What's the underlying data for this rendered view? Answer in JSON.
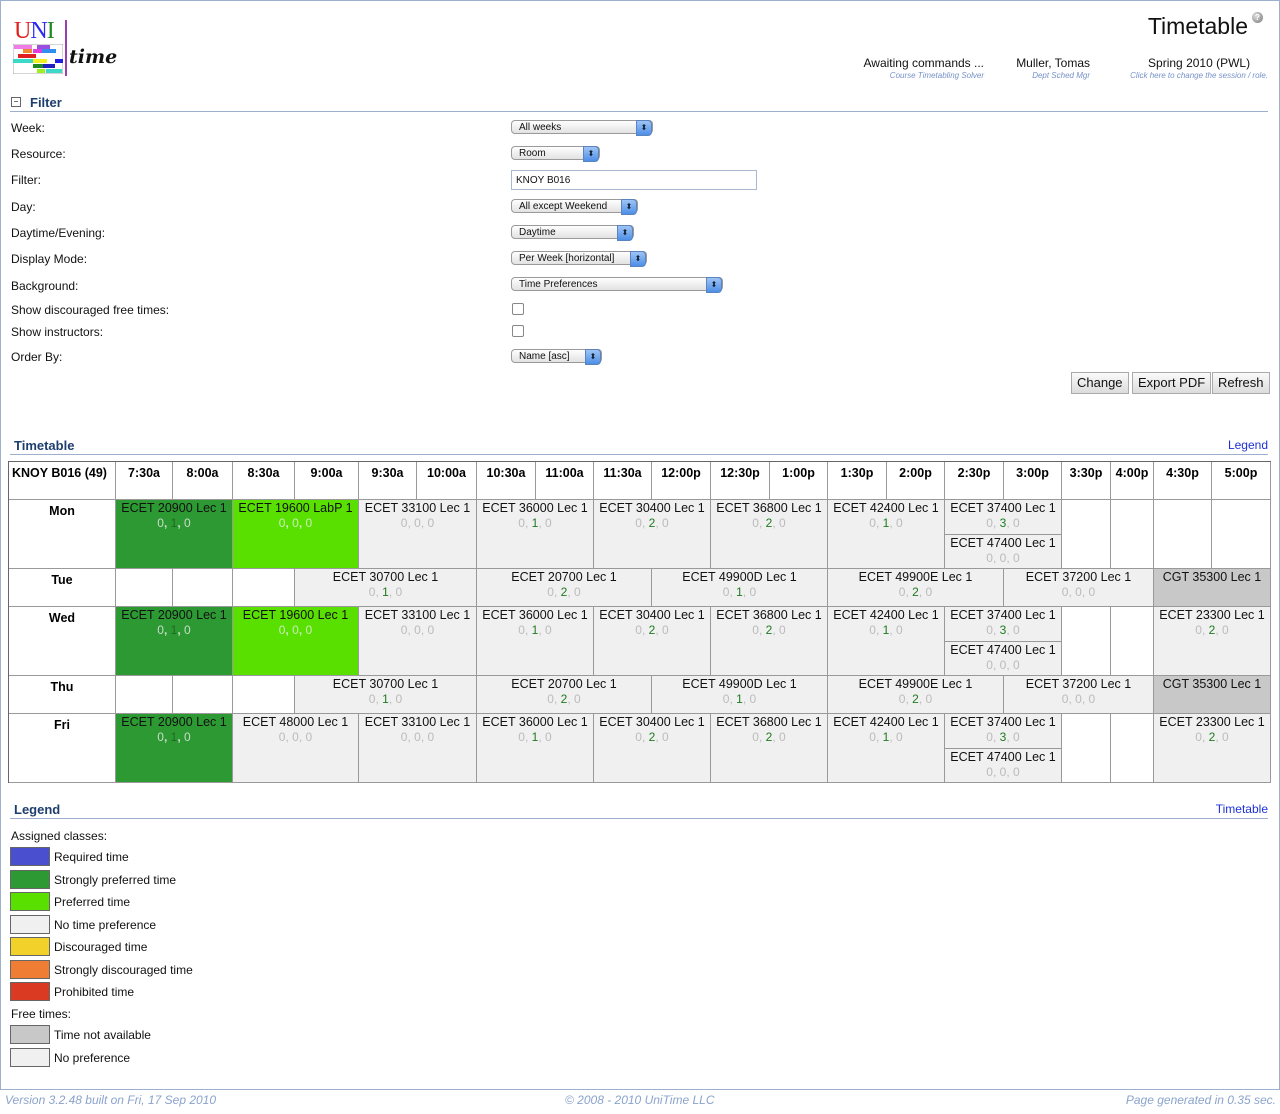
{
  "header": {
    "logo_alt": "UniTime",
    "page_title": "Timetable",
    "solver_status": "Awaiting commands ...",
    "solver_label": "Course Timetabling Solver",
    "user_name": "Muller, Tomas",
    "user_role": "Dept Sched Mgr",
    "session": "Spring 2010 (PWL)",
    "session_hint": "Click here to change the session / role."
  },
  "filter": {
    "title": "Filter",
    "fields": {
      "week": {
        "label": "Week:",
        "value": "All weeks"
      },
      "resource": {
        "label": "Resource:",
        "value": "Room"
      },
      "filter": {
        "label": "Filter:",
        "value": "KNOY B016"
      },
      "day": {
        "label": "Day:",
        "value": "All except Weekend"
      },
      "daytime": {
        "label": "Daytime/Evening:",
        "value": "Daytime"
      },
      "display_mode": {
        "label": "Display Mode:",
        "value": "Per Week [horizontal]"
      },
      "background": {
        "label": "Background:",
        "value": "Time Preferences"
      },
      "show_discouraged": {
        "label": "Show discouraged free times:",
        "checked": false
      },
      "show_instructors": {
        "label": "Show instructors:",
        "checked": false
      },
      "order_by": {
        "label": "Order By:",
        "value": "Name [asc]"
      }
    },
    "buttons": {
      "change": "Change",
      "export_pdf": "Export PDF",
      "refresh": "Refresh"
    }
  },
  "timetable": {
    "title": "Timetable",
    "legend_link": "Legend",
    "room": "KNOY B016 (49)",
    "times": [
      "7:30a",
      "8:00a",
      "8:30a",
      "9:00a",
      "9:30a",
      "10:00a",
      "10:30a",
      "11:00a",
      "11:30a",
      "12:00p",
      "12:30p",
      "1:00p",
      "1:30p",
      "2:00p",
      "2:30p",
      "3:00p",
      "3:30p",
      "4:00p",
      "4:30p",
      "5:00p"
    ],
    "days": [
      {
        "name": "Mon",
        "classes": [
          {
            "label": "ECET 20900 Lec 1",
            "pref": [
              "0",
              "1",
              "0"
            ],
            "start": 0,
            "span": 2,
            "type": "strongly-preferred",
            "row": 0,
            "rows": 2
          },
          {
            "label": "ECET 19600 LabP 1",
            "pref": [
              "0",
              "0",
              "0"
            ],
            "start": 2,
            "span": 2,
            "type": "preferred",
            "row": 0,
            "rows": 2
          },
          {
            "label": "ECET 33100 Lec 1",
            "pref": [
              "0",
              "0",
              "0"
            ],
            "start": 4,
            "span": 2,
            "type": "no-preference",
            "row": 0,
            "rows": 2
          },
          {
            "label": "ECET 36000 Lec 1",
            "pref": [
              "0",
              "1",
              "0"
            ],
            "start": 6,
            "span": 2,
            "type": "no-preference",
            "row": 0,
            "rows": 2
          },
          {
            "label": "ECET 30400 Lec 1",
            "pref": [
              "0",
              "2",
              "0"
            ],
            "start": 8,
            "span": 2,
            "type": "no-preference",
            "row": 0,
            "rows": 2
          },
          {
            "label": "ECET 36800 Lec 1",
            "pref": [
              "0",
              "2",
              "0"
            ],
            "start": 10,
            "span": 2,
            "type": "no-preference",
            "row": 0,
            "rows": 2
          },
          {
            "label": "ECET 42400 Lec 1",
            "pref": [
              "0",
              "1",
              "0"
            ],
            "start": 12,
            "span": 2,
            "type": "no-preference",
            "row": 0,
            "rows": 2
          },
          {
            "label": "ECET 37400 Lec 1",
            "pref": [
              "0",
              "3",
              "0"
            ],
            "start": 14,
            "span": 2,
            "type": "no-preference",
            "row": 0,
            "rows": 1
          },
          {
            "label": "ECET 47400 Lec 1",
            "pref": [
              "0",
              "0",
              "0"
            ],
            "start": 14,
            "span": 2,
            "type": "no-preference",
            "row": 1,
            "rows": 1
          }
        ],
        "empty": [
          16,
          17,
          18,
          19
        ],
        "lines": 2
      },
      {
        "name": "Tue",
        "classes": [
          {
            "label": "ECET 30700 Lec 1",
            "pref": [
              "0",
              "1",
              "0"
            ],
            "start": 3,
            "span": 3,
            "type": "no-preference",
            "row": 0,
            "rows": 1
          },
          {
            "label": "ECET 20700 Lec 1",
            "pref": [
              "0",
              "2",
              "0"
            ],
            "start": 6,
            "span": 3,
            "type": "no-preference",
            "row": 0,
            "rows": 1
          },
          {
            "label": "ECET 49900D Lec 1",
            "pref": [
              "0",
              "1",
              "0"
            ],
            "start": 9,
            "span": 3,
            "type": "no-preference",
            "row": 0,
            "rows": 1
          },
          {
            "label": "ECET 49900E Lec 1",
            "pref": [
              "0",
              "2",
              "0"
            ],
            "start": 12,
            "span": 3,
            "type": "no-preference",
            "row": 0,
            "rows": 1
          },
          {
            "label": "ECET 37200 Lec 1",
            "pref": [
              "0",
              "0",
              "0"
            ],
            "start": 15,
            "span": 3,
            "type": "no-preference",
            "row": 0,
            "rows": 1
          },
          {
            "label": "CGT 35300 Lec 1",
            "pref": null,
            "start": 18,
            "span": 2,
            "type": "not-available",
            "row": 0,
            "rows": 1
          }
        ],
        "empty": [
          0,
          1,
          2
        ],
        "lines": 1
      },
      {
        "name": "Wed",
        "classes": [
          {
            "label": "ECET 20900 Lec 1",
            "pref": [
              "0",
              "1",
              "0"
            ],
            "start": 0,
            "span": 2,
            "type": "strongly-preferred",
            "row": 0,
            "rows": 2
          },
          {
            "label": "ECET 19600 Lec 1",
            "pref": [
              "0",
              "0",
              "0"
            ],
            "start": 2,
            "span": 2,
            "type": "preferred",
            "row": 0,
            "rows": 2
          },
          {
            "label": "ECET 33100 Lec 1",
            "pref": [
              "0",
              "0",
              "0"
            ],
            "start": 4,
            "span": 2,
            "type": "no-preference",
            "row": 0,
            "rows": 2
          },
          {
            "label": "ECET 36000 Lec 1",
            "pref": [
              "0",
              "1",
              "0"
            ],
            "start": 6,
            "span": 2,
            "type": "no-preference",
            "row": 0,
            "rows": 2
          },
          {
            "label": "ECET 30400 Lec 1",
            "pref": [
              "0",
              "2",
              "0"
            ],
            "start": 8,
            "span": 2,
            "type": "no-preference",
            "row": 0,
            "rows": 2
          },
          {
            "label": "ECET 36800 Lec 1",
            "pref": [
              "0",
              "2",
              "0"
            ],
            "start": 10,
            "span": 2,
            "type": "no-preference",
            "row": 0,
            "rows": 2
          },
          {
            "label": "ECET 42400 Lec 1",
            "pref": [
              "0",
              "1",
              "0"
            ],
            "start": 12,
            "span": 2,
            "type": "no-preference",
            "row": 0,
            "rows": 2
          },
          {
            "label": "ECET 37400 Lec 1",
            "pref": [
              "0",
              "3",
              "0"
            ],
            "start": 14,
            "span": 2,
            "type": "no-preference",
            "row": 0,
            "rows": 1
          },
          {
            "label": "ECET 47400 Lec 1",
            "pref": [
              "0",
              "0",
              "0"
            ],
            "start": 14,
            "span": 2,
            "type": "no-preference",
            "row": 1,
            "rows": 1
          },
          {
            "label": "ECET 23300 Lec 1",
            "pref": [
              "0",
              "2",
              "0"
            ],
            "start": 18,
            "span": 2,
            "type": "no-preference",
            "row": 0,
            "rows": 2
          }
        ],
        "empty": [
          16,
          17
        ],
        "lines": 2
      },
      {
        "name": "Thu",
        "classes": [
          {
            "label": "ECET 30700 Lec 1",
            "pref": [
              "0",
              "1",
              "0"
            ],
            "start": 3,
            "span": 3,
            "type": "no-preference",
            "row": 0,
            "rows": 1
          },
          {
            "label": "ECET 20700 Lec 1",
            "pref": [
              "0",
              "2",
              "0"
            ],
            "start": 6,
            "span": 3,
            "type": "no-preference",
            "row": 0,
            "rows": 1
          },
          {
            "label": "ECET 49900D Lec 1",
            "pref": [
              "0",
              "1",
              "0"
            ],
            "start": 9,
            "span": 3,
            "type": "no-preference",
            "row": 0,
            "rows": 1
          },
          {
            "label": "ECET 49900E Lec 1",
            "pref": [
              "0",
              "2",
              "0"
            ],
            "start": 12,
            "span": 3,
            "type": "no-preference",
            "row": 0,
            "rows": 1
          },
          {
            "label": "ECET 37200 Lec 1",
            "pref": [
              "0",
              "0",
              "0"
            ],
            "start": 15,
            "span": 3,
            "type": "no-preference",
            "row": 0,
            "rows": 1
          },
          {
            "label": "CGT 35300 Lec 1",
            "pref": null,
            "start": 18,
            "span": 2,
            "type": "not-available",
            "row": 0,
            "rows": 1
          }
        ],
        "empty": [
          0,
          1,
          2
        ],
        "lines": 1
      },
      {
        "name": "Fri",
        "classes": [
          {
            "label": "ECET 20900 Lec 1",
            "pref": [
              "0",
              "1",
              "0"
            ],
            "start": 0,
            "span": 2,
            "type": "strongly-preferred",
            "row": 0,
            "rows": 2
          },
          {
            "label": "ECET 48000 Lec 1",
            "pref": [
              "0",
              "0",
              "0"
            ],
            "start": 2,
            "span": 2,
            "type": "no-preference",
            "row": 0,
            "rows": 2
          },
          {
            "label": "ECET 33100 Lec 1",
            "pref": [
              "0",
              "0",
              "0"
            ],
            "start": 4,
            "span": 2,
            "type": "no-preference",
            "row": 0,
            "rows": 2
          },
          {
            "label": "ECET 36000 Lec 1",
            "pref": [
              "0",
              "1",
              "0"
            ],
            "start": 6,
            "span": 2,
            "type": "no-preference",
            "row": 0,
            "rows": 2
          },
          {
            "label": "ECET 30400 Lec 1",
            "pref": [
              "0",
              "2",
              "0"
            ],
            "start": 8,
            "span": 2,
            "type": "no-preference",
            "row": 0,
            "rows": 2
          },
          {
            "label": "ECET 36800 Lec 1",
            "pref": [
              "0",
              "2",
              "0"
            ],
            "start": 10,
            "span": 2,
            "type": "no-preference",
            "row": 0,
            "rows": 2
          },
          {
            "label": "ECET 42400 Lec 1",
            "pref": [
              "0",
              "1",
              "0"
            ],
            "start": 12,
            "span": 2,
            "type": "no-preference",
            "row": 0,
            "rows": 2
          },
          {
            "label": "ECET 37400 Lec 1",
            "pref": [
              "0",
              "3",
              "0"
            ],
            "start": 14,
            "span": 2,
            "type": "no-preference",
            "row": 0,
            "rows": 1
          },
          {
            "label": "ECET 47400 Lec 1",
            "pref": [
              "0",
              "0",
              "0"
            ],
            "start": 14,
            "span": 2,
            "type": "no-preference",
            "row": 1,
            "rows": 1
          },
          {
            "label": "ECET 23300 Lec 1",
            "pref": [
              "0",
              "2",
              "0"
            ],
            "start": 18,
            "span": 2,
            "type": "no-preference",
            "row": 0,
            "rows": 2
          }
        ],
        "empty": [
          16,
          17
        ],
        "lines": 2
      }
    ]
  },
  "legend": {
    "title": "Legend",
    "timetable_link": "Timetable",
    "assigned_heading": "Assigned classes:",
    "assigned": [
      {
        "label": "Required time",
        "color": "#4a4fcf"
      },
      {
        "label": "Strongly preferred time",
        "color": "#2c9932"
      },
      {
        "label": "Preferred time",
        "color": "#59e000"
      },
      {
        "label": "No time preference",
        "color": "#f0f0f0"
      },
      {
        "label": "Discouraged time",
        "color": "#f2d22a"
      },
      {
        "label": "Strongly discouraged time",
        "color": "#ef7d33"
      },
      {
        "label": "Prohibited time",
        "color": "#da3a22"
      }
    ],
    "free_heading": "Free times:",
    "free": [
      {
        "label": "Time not available",
        "color": "#c8c8c8"
      },
      {
        "label": "No preference",
        "color": "#f0f0f0"
      }
    ]
  },
  "footer": {
    "version": "Version 3.2.48 built on Fri, 17 Sep 2010",
    "copyright": "© 2008 - 2010 UniTime LLC",
    "generated": "Page generated in 0.35 sec."
  }
}
